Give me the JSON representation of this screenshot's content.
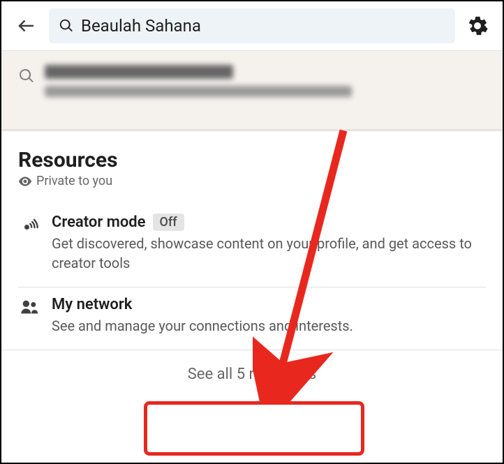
{
  "header": {
    "search_value": "Beaulah Sahana"
  },
  "analytics": {
    "title_placeholder": "8 search appearances",
    "subtitle_placeholder": "See how often you appear in search results."
  },
  "resources": {
    "heading": "Resources",
    "privacy_label": "Private to you",
    "items": [
      {
        "name": "Creator mode",
        "badge": "Off",
        "description": "Get discovered, showcase content on your profile, and get access to creator tools"
      },
      {
        "name": "My network",
        "badge": null,
        "description": "See and manage your connections and interests."
      }
    ],
    "see_all_label": "See all 5 resources"
  }
}
